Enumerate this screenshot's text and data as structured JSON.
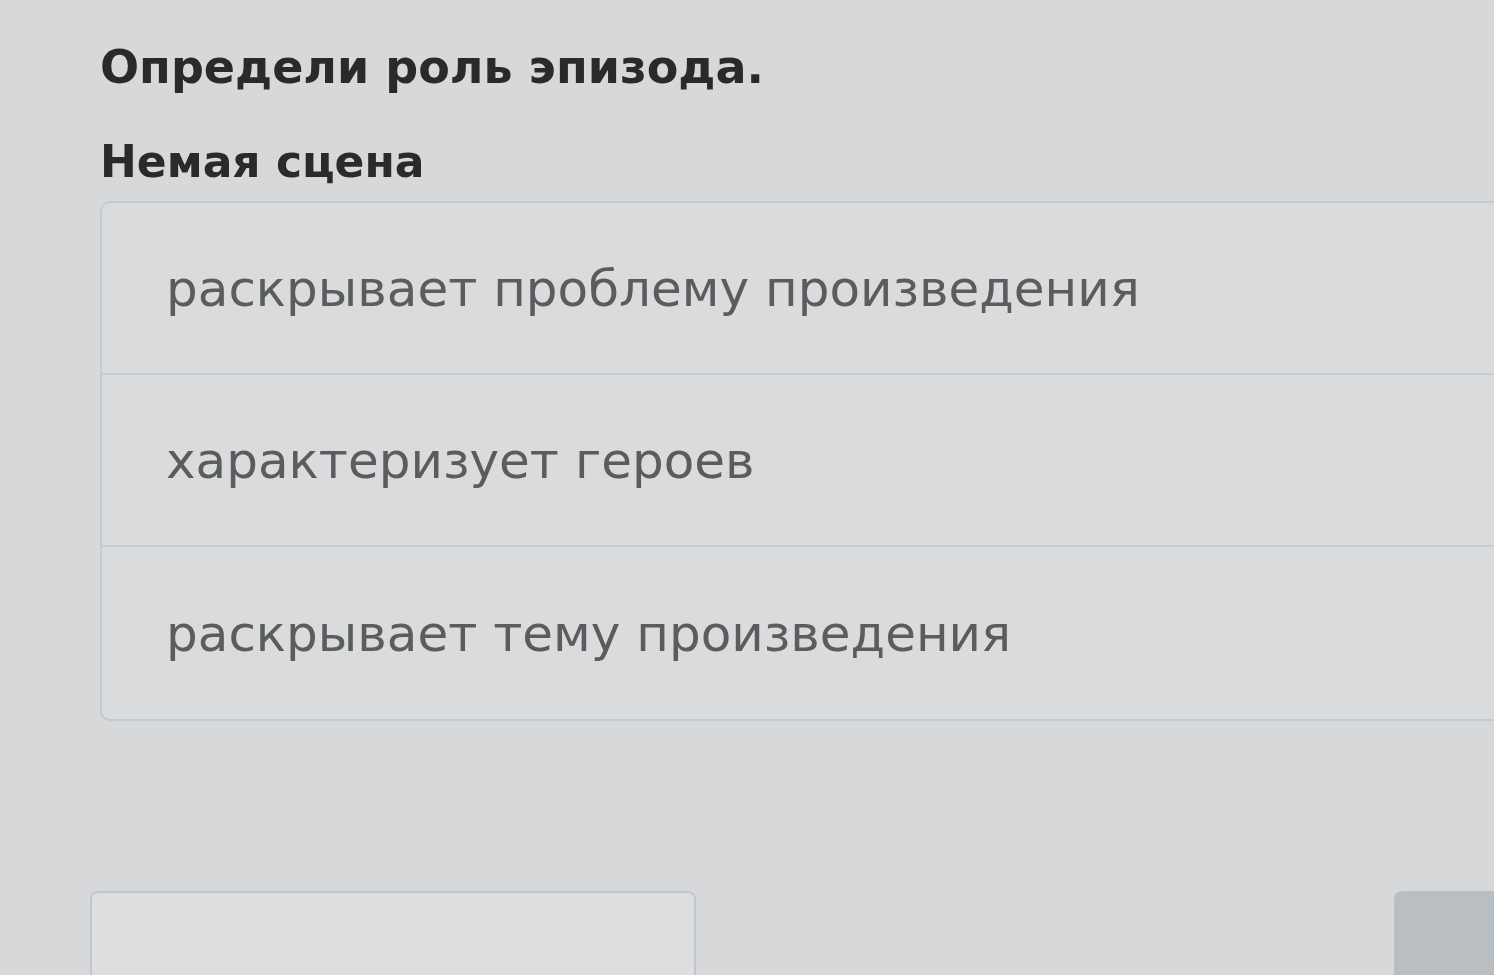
{
  "question": {
    "title": "Определи роль эпизода.",
    "episode": "Немая сцена"
  },
  "options": [
    {
      "label": "раскрывает проблему произведения",
      "selected": false
    },
    {
      "label": "характеризует героев",
      "selected": false
    },
    {
      "label": "раскрывает тему произведения",
      "selected": false
    }
  ]
}
